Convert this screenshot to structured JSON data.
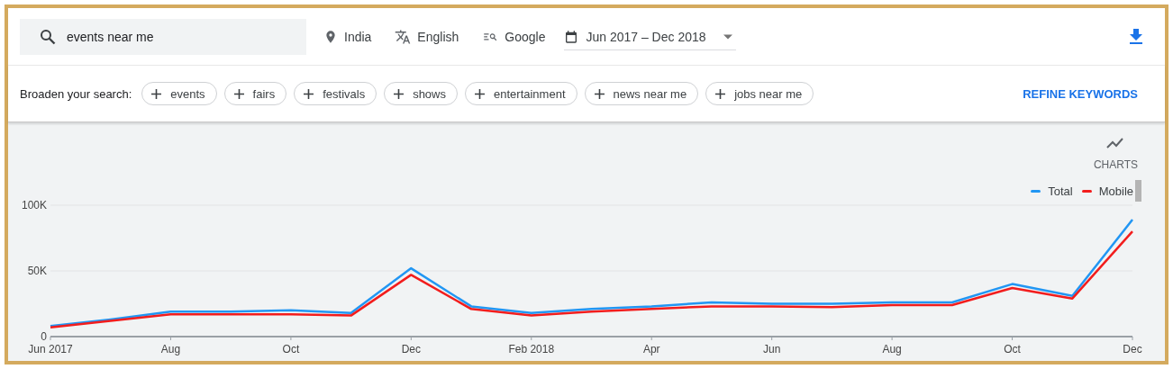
{
  "search": {
    "value": "events near me"
  },
  "filters": [
    {
      "kind": "location",
      "label": "India"
    },
    {
      "kind": "language",
      "label": "English"
    },
    {
      "kind": "network",
      "label": "Google"
    }
  ],
  "date_range": {
    "label": "Jun 2017 – Dec 2018"
  },
  "broaden": {
    "label": "Broaden your search:",
    "chips": [
      "events",
      "fairs",
      "festivals",
      "shows",
      "entertainment",
      "news near me",
      "jobs near me"
    ]
  },
  "refine_button": "REFINE KEYWORDS",
  "chart": {
    "toggle_label": "CHARTS",
    "chart_data": {
      "type": "line",
      "categories": [
        "Jun 2017",
        null,
        "Aug",
        null,
        "Oct",
        null,
        "Dec",
        null,
        "Feb 2018",
        null,
        "Apr",
        null,
        "Jun",
        null,
        "Aug",
        null,
        "Oct",
        null,
        "Dec"
      ],
      "yticks": [
        {
          "value": 0,
          "label": "0"
        },
        {
          "value": 50000,
          "label": "50K"
        },
        {
          "value": 100000,
          "label": "100K"
        }
      ],
      "ylim": [
        0,
        100000
      ],
      "series": [
        {
          "name": "Total",
          "color": "#2196f3",
          "values": [
            8000,
            13000,
            19000,
            19000,
            20000,
            18000,
            52000,
            23000,
            18000,
            21000,
            23000,
            26000,
            25000,
            25000,
            26000,
            26000,
            40000,
            31000,
            89000
          ]
        },
        {
          "name": "Mobile",
          "color": "#f21d1d",
          "values": [
            7000,
            12000,
            17000,
            17000,
            17000,
            16000,
            47000,
            21000,
            16000,
            19000,
            21000,
            23000,
            23000,
            22500,
            24000,
            24000,
            37000,
            29000,
            80000
          ]
        }
      ]
    }
  }
}
